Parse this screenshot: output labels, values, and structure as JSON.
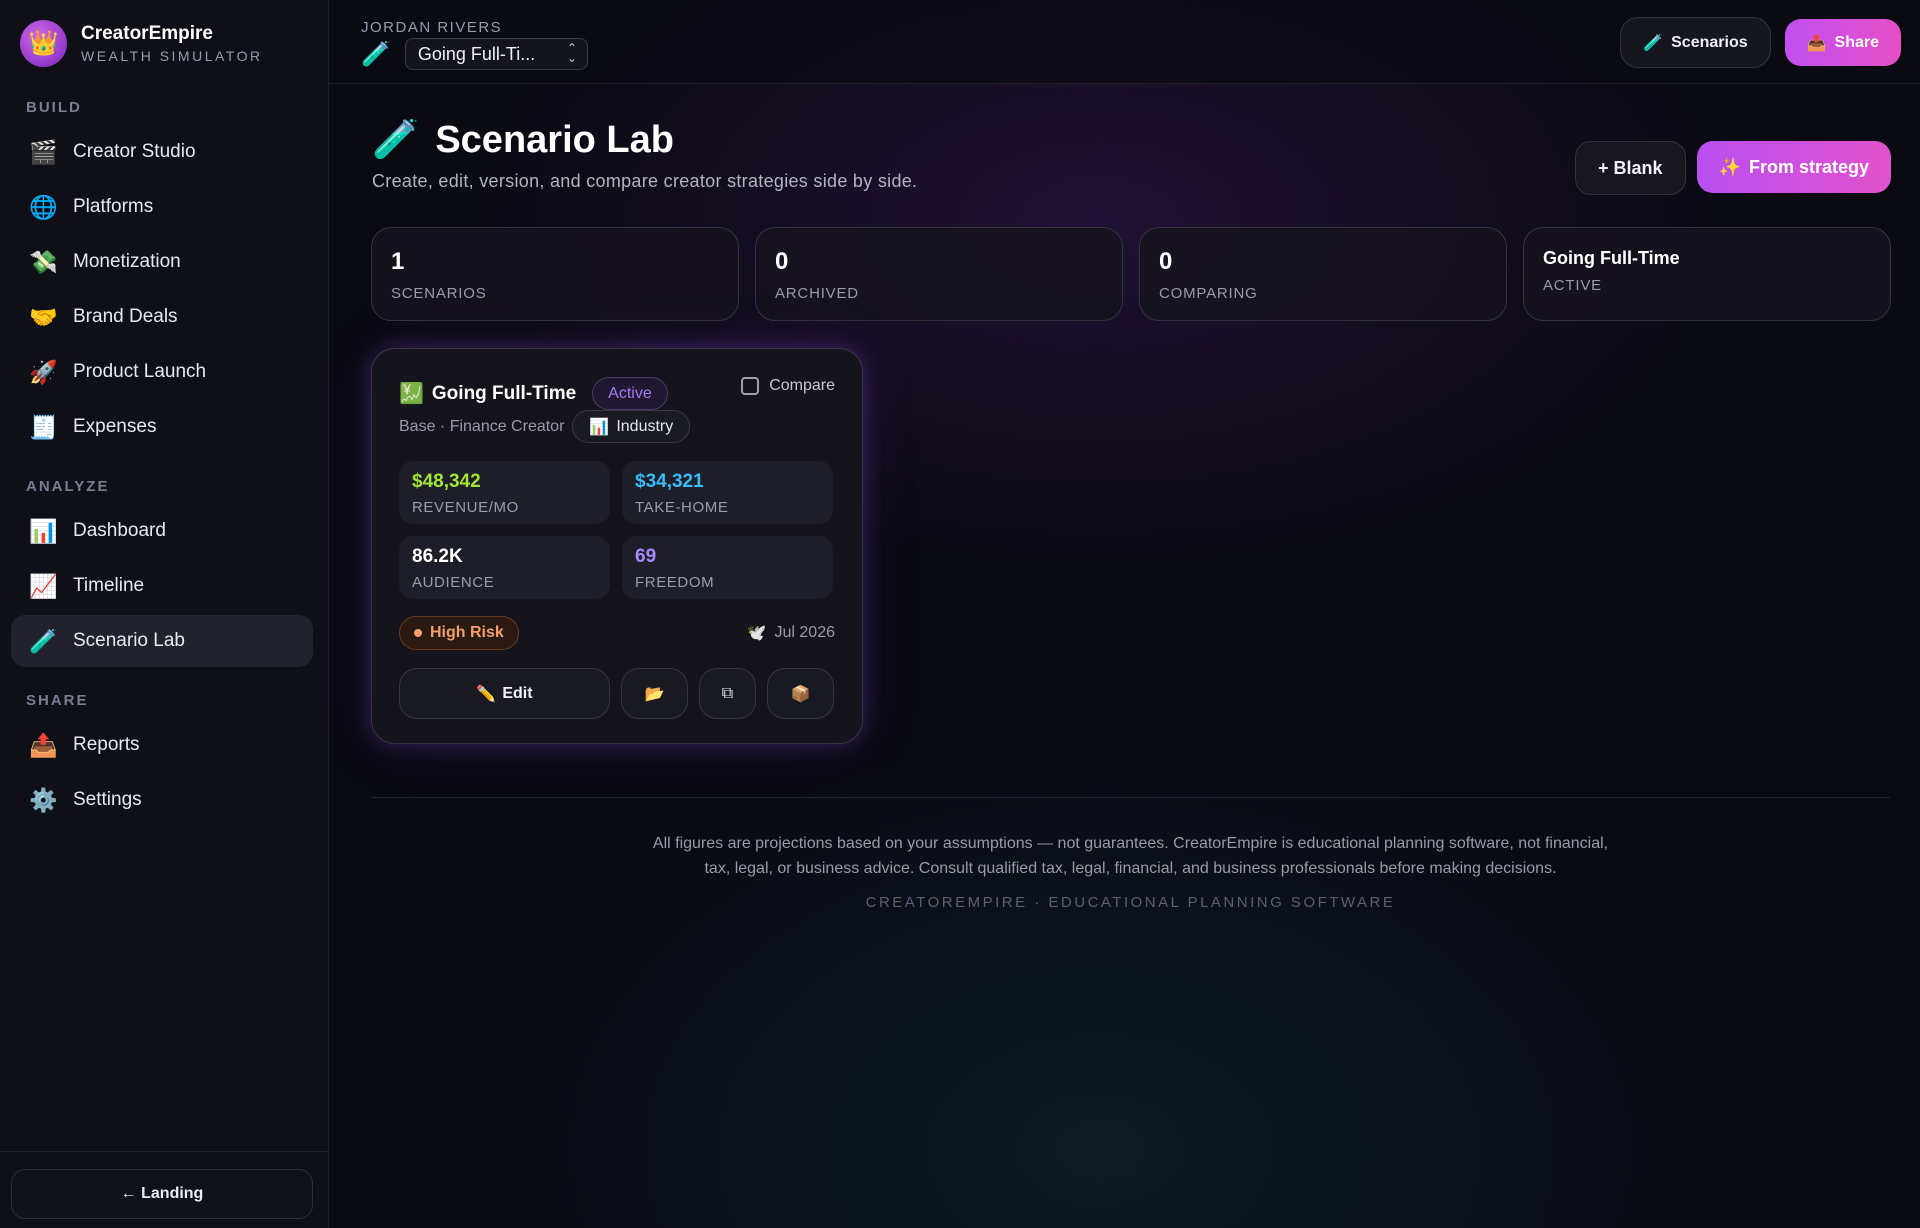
{
  "brand": {
    "name": "CreatorEmpire",
    "tagline": "WEALTH SIMULATOR",
    "logo_icon": "crown-icon"
  },
  "sidebar": {
    "sections": [
      {
        "label": "BUILD",
        "items": [
          {
            "label": "Creator Studio",
            "icon": "clapperboard-icon",
            "glyph": "🎬"
          },
          {
            "label": "Platforms",
            "icon": "globe-icon",
            "glyph": "🌐"
          },
          {
            "label": "Monetization",
            "icon": "money-wings-icon",
            "glyph": "💸"
          },
          {
            "label": "Brand Deals",
            "icon": "handshake-icon",
            "glyph": "🤝"
          },
          {
            "label": "Product Launch",
            "icon": "rocket-icon",
            "glyph": "🚀"
          },
          {
            "label": "Expenses",
            "icon": "receipt-icon",
            "glyph": "🧾"
          }
        ]
      },
      {
        "label": "ANALYZE",
        "items": [
          {
            "label": "Dashboard",
            "icon": "bar-chart-icon",
            "glyph": "📊"
          },
          {
            "label": "Timeline",
            "icon": "line-chart-icon",
            "glyph": "📈"
          },
          {
            "label": "Scenario Lab",
            "icon": "test-tube-icon",
            "glyph": "🧪",
            "active": true
          }
        ]
      },
      {
        "label": "SHARE",
        "items": [
          {
            "label": "Reports",
            "icon": "outbox-tray-icon",
            "glyph": "📤"
          },
          {
            "label": "Settings",
            "icon": "gear-icon",
            "glyph": "⚙️"
          }
        ]
      }
    ],
    "footer_button": "← Landing"
  },
  "topbar": {
    "user": "JORDAN RIVERS",
    "scenario_select": "Going Full-Ti...",
    "scenarios_button": "Scenarios",
    "share_button": "Share"
  },
  "page": {
    "title": "Scenario Lab",
    "subtitle": "Create, edit, version, and compare creator strategies side by side.",
    "blank_button": "+ Blank",
    "strategy_button": "From strategy"
  },
  "stats": [
    {
      "value": "1",
      "label": "SCENARIOS"
    },
    {
      "value": "0",
      "label": "ARCHIVED"
    },
    {
      "value": "0",
      "label": "COMPARING"
    },
    {
      "value": "Going Full-Time",
      "label": "ACTIVE"
    }
  ],
  "card": {
    "title": "Going Full-Time",
    "status": "Active",
    "compare_label": "Compare",
    "meta": "Base · Finance Creator",
    "chip": "Industry",
    "metrics": [
      {
        "value": "$48,342",
        "label": "REVENUE/MO",
        "color": "#a3e635"
      },
      {
        "value": "$34,321",
        "label": "TAKE-HOME",
        "color": "#38bdf8"
      },
      {
        "value": "86.2K",
        "label": "AUDIENCE",
        "color": "#ffffff"
      },
      {
        "value": "69",
        "label": "FREEDOM",
        "color": "#a78bfa"
      }
    ],
    "risk": "High Risk",
    "date": "Jul 2026",
    "edit_button": "Edit"
  },
  "footer": {
    "disclaimer_line1": "All figures are projections based on your assumptions — not guarantees. CreatorEmpire is educational planning software, not financial,",
    "disclaimer_line2": "tax, legal, or business advice. Consult qualified tax, legal, financial, and business professionals before making decisions.",
    "tag": "CREATOREMPIRE · EDUCATIONAL PLANNING SOFTWARE"
  },
  "colors": {
    "accent": "#c04ff0",
    "accent2": "#e64fc6",
    "active_badge": "#a67cf5",
    "risk": "#f29f6b"
  }
}
